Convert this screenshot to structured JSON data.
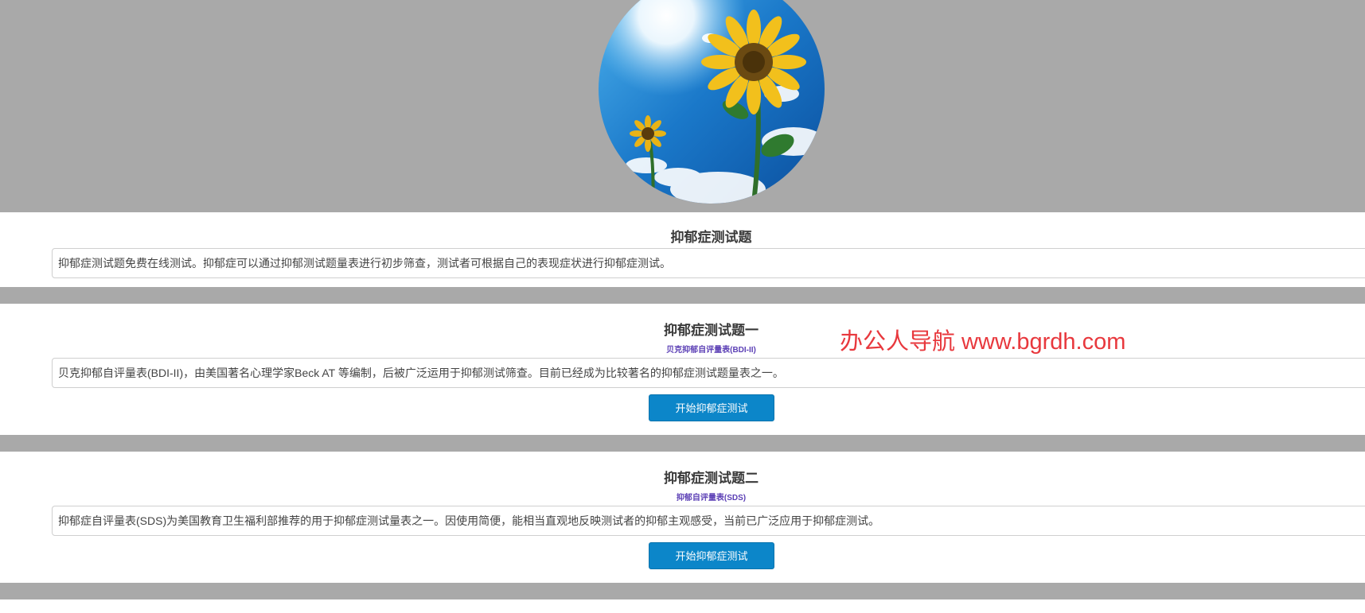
{
  "header": {
    "image": "sunflower-sky-image"
  },
  "intro": {
    "title": "抑郁症测试题",
    "description": "抑郁症测试题免费在线测试。抑郁症可以通过抑郁测试题量表进行初步筛查，测试者可根据自己的表现症状进行抑郁症测试。"
  },
  "tests": [
    {
      "title": "抑郁症测试题一",
      "subtitle": "贝克抑郁自评量表(BDI-II)",
      "description": "贝克抑郁自评量表(BDI-II)，由美国著名心理学家Beck AT 等编制，后被广泛运用于抑郁测试筛查。目前已经成为比较著名的抑郁症测试题量表之一。",
      "button_label": "开始抑郁症测试"
    },
    {
      "title": "抑郁症测试题二",
      "subtitle": "抑郁自评量表(SDS)",
      "description": "抑郁症自评量表(SDS)为美国教育卫生福利部推荐的用于抑郁症测试量表之一。因使用简便，能相当直观地反映测试者的抑郁主观感受，当前已广泛应用于抑郁症测试。",
      "button_label": "开始抑郁症测试"
    }
  ],
  "watermark": "办公人导航 www.bgrdh.com",
  "colors": {
    "band_gray": "#a9a9a9",
    "button_blue": "#0c86c9",
    "subtitle_purple": "#5b3fb5",
    "watermark_red": "#e8383d"
  }
}
